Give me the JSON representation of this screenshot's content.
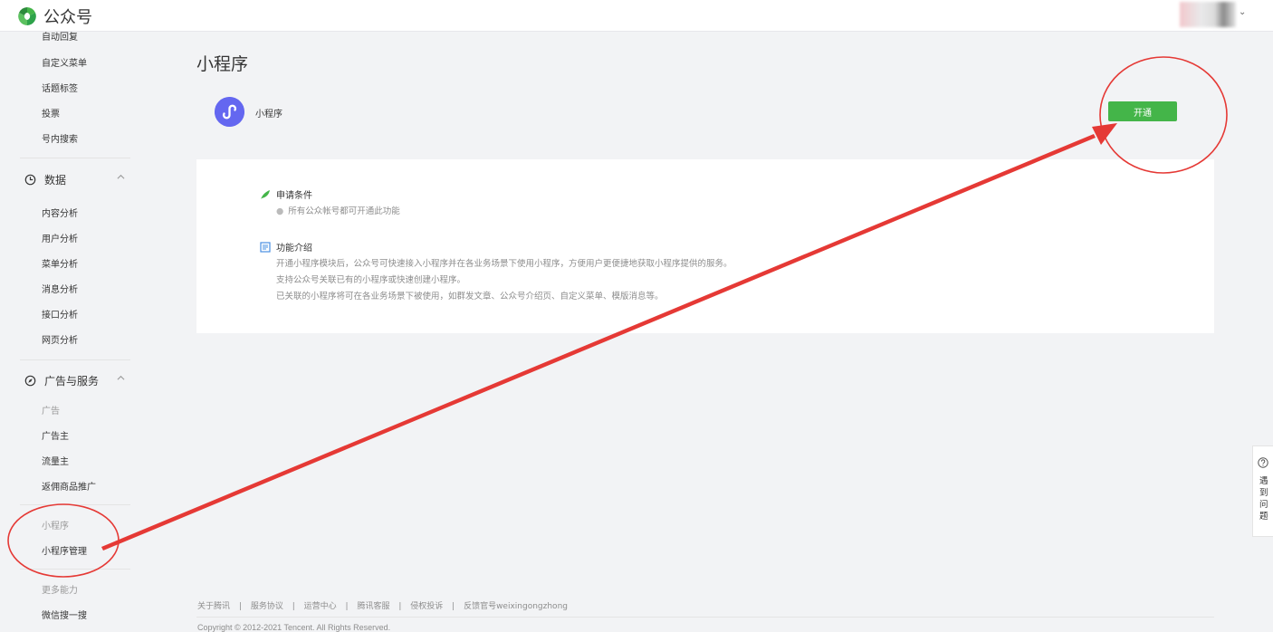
{
  "header": {
    "brand": "公众号"
  },
  "sidebar": {
    "cut_top_item": "自动回复",
    "interactive_items": [
      "自定义菜单",
      "话题标签",
      "投票",
      "号内搜索"
    ],
    "data_section": {
      "title": "数据",
      "items": [
        "内容分析",
        "用户分析",
        "菜单分析",
        "消息分析",
        "接口分析",
        "网页分析"
      ]
    },
    "ads_section": {
      "title": "广告与服务",
      "items": [
        "广告",
        "广告主",
        "流量主",
        "返佣商品推广"
      ]
    },
    "mini_section": {
      "title": "小程序",
      "items": [
        "小程序管理"
      ]
    },
    "more_section": {
      "title": "更多能力",
      "items": [
        "微信搜一搜"
      ]
    }
  },
  "main": {
    "title": "小程序",
    "mini_program_name": "小程序",
    "open_button": "开通",
    "conditions": {
      "title": "申请条件",
      "items": [
        "所有公众帐号都可开通此功能"
      ]
    },
    "features": {
      "title": "功能介绍",
      "lines": [
        "开通小程序模块后，公众号可快速接入小程序并在各业务场景下使用小程序，方便用户更便捷地获取小程序提供的服务。",
        "支持公众号关联已有的小程序或快速创建小程序。",
        "已关联的小程序将可在各业务场景下被使用，如群发文章、公众号介绍页、自定义菜单、模版消息等。"
      ]
    }
  },
  "help": {
    "label": "遇到问题"
  },
  "footer": {
    "links": [
      "关于腾讯",
      "服务协议",
      "运营中心",
      "腾讯客服",
      "侵权投诉",
      "反馈官号weixingongzhong"
    ],
    "separator": "|",
    "copyright": "Copyright © 2012-2021 Tencent. All Rights Reserved."
  },
  "colors": {
    "primary_green": "#44b549",
    "mini_program_blue": "#6467f0",
    "annotation_red": "#e53935"
  },
  "icons": [
    "wechat-logo-icon",
    "data-chart-icon",
    "compass-icon",
    "chevron-up-icon",
    "mini-program-icon",
    "leaf-icon",
    "document-icon",
    "help-icon"
  ]
}
